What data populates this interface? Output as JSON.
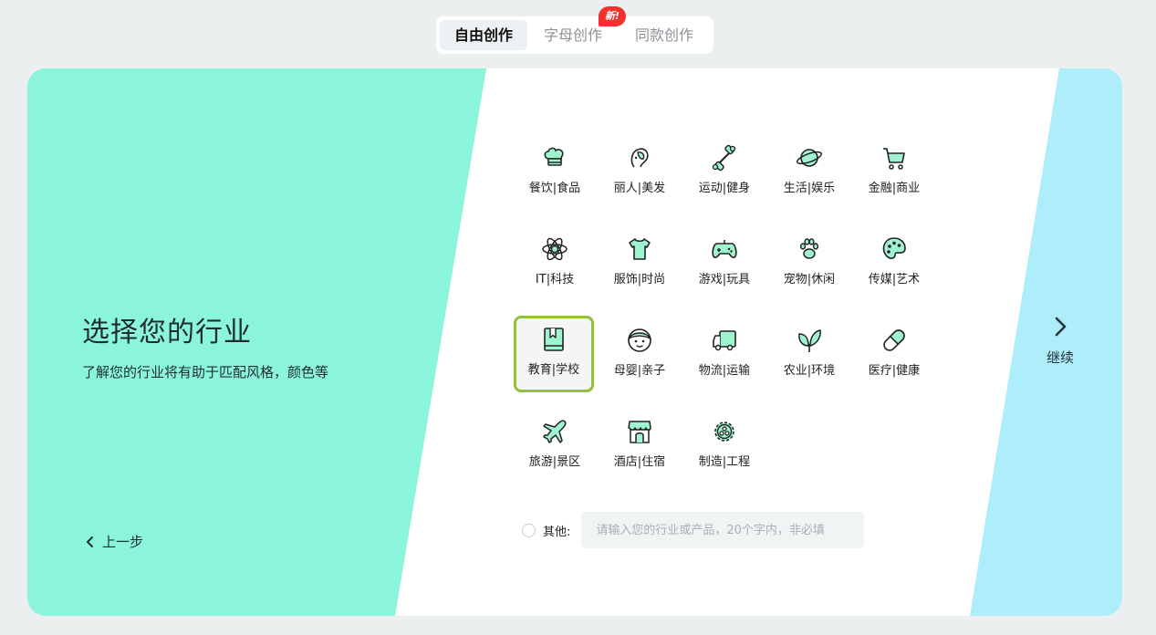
{
  "tabs": [
    {
      "label": "自由创作"
    },
    {
      "label": "字母创作"
    },
    {
      "label": "同款创作"
    }
  ],
  "new_badge": "新!",
  "intro": {
    "title": "选择您的行业",
    "subtitle": "了解您的行业将有助于匹配风格，颜色等"
  },
  "back_label": "上一步",
  "continue_label": "继续",
  "industries": [
    {
      "label": "餐饮|食品",
      "icon": "chef-hat-icon"
    },
    {
      "label": "丽人|美发",
      "icon": "beauty-face-icon"
    },
    {
      "label": "运动|健身",
      "icon": "dumbbell-icon"
    },
    {
      "label": "生活|娱乐",
      "icon": "planet-icon"
    },
    {
      "label": "金融|商业",
      "icon": "shopping-cart-icon"
    },
    {
      "label": "IT|科技",
      "icon": "atom-icon"
    },
    {
      "label": "服饰|时尚",
      "icon": "tshirt-icon"
    },
    {
      "label": "游戏|玩具",
      "icon": "gamepad-icon"
    },
    {
      "label": "宠物|休闲",
      "icon": "paw-icon"
    },
    {
      "label": "传媒|艺术",
      "icon": "palette-icon"
    },
    {
      "label": "教育|学校",
      "icon": "book-icon",
      "selected": true
    },
    {
      "label": "母婴|亲子",
      "icon": "baby-face-icon"
    },
    {
      "label": "物流|运输",
      "icon": "truck-icon"
    },
    {
      "label": "农业|环境",
      "icon": "leaf-icon"
    },
    {
      "label": "医疗|健康",
      "icon": "pill-icon"
    },
    {
      "label": "旅游|景区",
      "icon": "airplane-icon"
    },
    {
      "label": "酒店|住宿",
      "icon": "storefront-icon"
    },
    {
      "label": "制造|工程",
      "icon": "gear-icon"
    }
  ],
  "other": {
    "label": "其他:",
    "placeholder": "请输入您的行业或产品，20个字内，非必填",
    "value": ""
  },
  "colors": {
    "left_panel": "#8af5da",
    "right_panel": "#aeeefb",
    "selected_border": "#93c23a",
    "badge": "#f2302e"
  }
}
